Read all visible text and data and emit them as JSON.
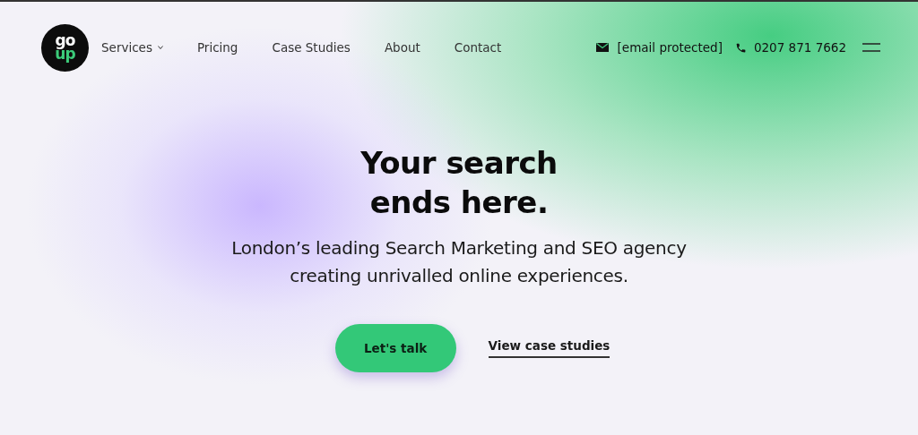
{
  "logo": {
    "top": "go",
    "bottom": "up"
  },
  "nav": [
    {
      "label": "Services",
      "has_dropdown": true
    },
    {
      "label": "Pricing",
      "has_dropdown": false
    },
    {
      "label": "Case Studies",
      "has_dropdown": false
    },
    {
      "label": "About",
      "has_dropdown": false
    },
    {
      "label": "Contact",
      "has_dropdown": false
    }
  ],
  "contact": {
    "email": "[email protected]",
    "phone": "0207 871 7662"
  },
  "hero": {
    "title_lines": [
      "Your search",
      "ends here."
    ],
    "subtitle_lines": [
      "London’s leading Search Marketing and SEO agency",
      "creating unrivalled online experiences."
    ],
    "primary_button": "Let's talk",
    "secondary_link": "View case studies"
  }
}
